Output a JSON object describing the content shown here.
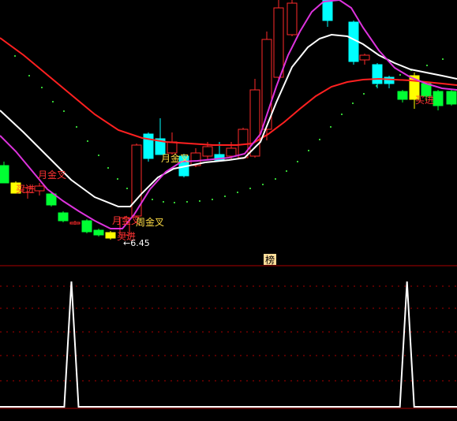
{
  "chart_data": [
    {
      "type": "candlestick",
      "title": "",
      "price_min_label": "6.45",
      "annotations": [
        {
          "label": "月金叉",
          "color": "#ff3333"
        },
        {
          "label": "买进",
          "color": "#ff3333"
        },
        {
          "label": "月金叉",
          "color": "#ff3333"
        },
        {
          "label": "周金叉",
          "color": "#ffdd44"
        },
        {
          "label": "买进",
          "color": "#ff3333"
        },
        {
          "label": "月金叉",
          "color": "#ffdd44"
        },
        {
          "label": "买进",
          "color": "#ff3333"
        }
      ],
      "panel_badge": "榜",
      "colors": {
        "up_candle": "#ff2a2a",
        "down_candle": "#00ffff",
        "green_bar": "#00ff33",
        "yellow_bar": "#ffff00",
        "ma_short": "#dd33dd",
        "ma_mid": "#ffffff",
        "ma_long": "#ff2020",
        "dots": "#33cc33",
        "grid": "#aa0000"
      }
    },
    {
      "type": "line",
      "title": "",
      "series": [
        {
          "values": [
            0,
            0,
            0,
            0,
            0,
            0,
            0,
            0,
            0,
            0,
            1,
            0,
            0,
            0,
            0,
            0,
            0,
            0,
            0,
            0,
            0,
            0,
            0,
            0,
            0,
            0,
            0,
            0,
            0,
            0,
            0,
            0,
            0,
            0,
            0,
            0,
            0,
            0,
            0,
            0,
            0,
            0,
            0,
            0,
            0,
            0,
            0,
            0,
            0,
            0,
            0,
            0,
            0,
            0,
            0,
            0,
            0,
            1,
            0,
            0,
            0,
            0,
            0,
            0,
            0
          ]
        }
      ],
      "ylim": [
        0,
        1
      ],
      "colors": {
        "line": "#ffffff",
        "grid": "#aa0000"
      }
    }
  ]
}
